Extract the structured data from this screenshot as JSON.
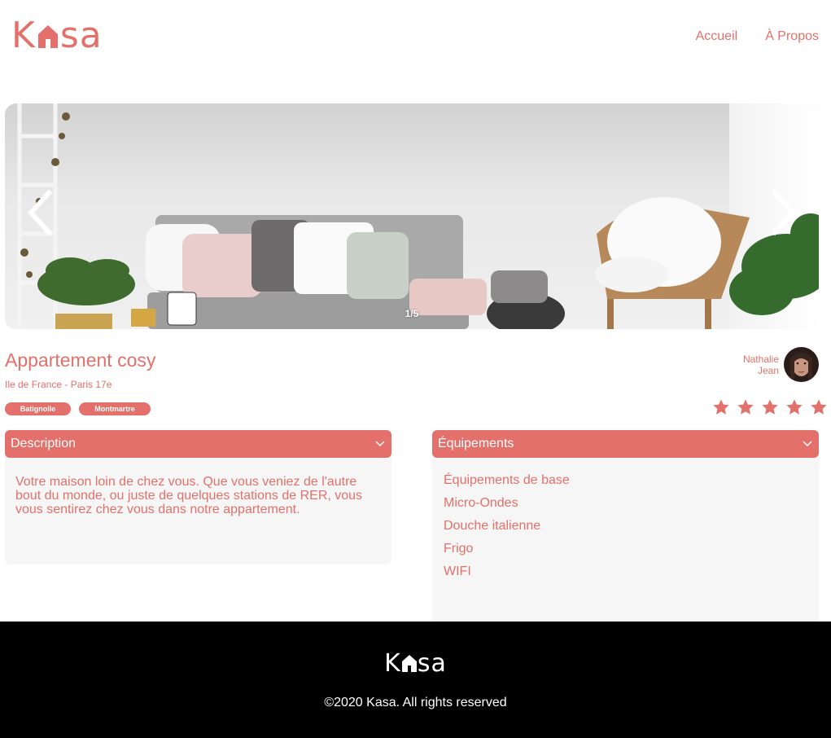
{
  "brand": {
    "letters_left": "K",
    "letters_right": "sa",
    "color": "#E3706A"
  },
  "nav": {
    "home": "Accueil",
    "about": "À Propos"
  },
  "carousel": {
    "counter": "1/5"
  },
  "listing": {
    "title": "Appartement cosy",
    "location": "Ile de France - Paris 17e",
    "tags": [
      "Batignolle",
      "Montmartre"
    ],
    "host_first": "Nathalie",
    "host_last": "Jean",
    "rating": 5
  },
  "description": {
    "label": "Description",
    "text": "Votre maison loin de chez vous. Que vous veniez de l'autre bout du monde, ou juste de quelques stations de RER, vous vous sentirez chez vous dans notre appartement."
  },
  "equipments": {
    "label": "Équipements",
    "items": [
      "Équipements de base",
      "Micro-Ondes",
      "Douche italienne",
      "Frigo",
      "WIFI"
    ]
  },
  "footer": {
    "copyright": "©2020 Kasa. All rights reserved"
  }
}
